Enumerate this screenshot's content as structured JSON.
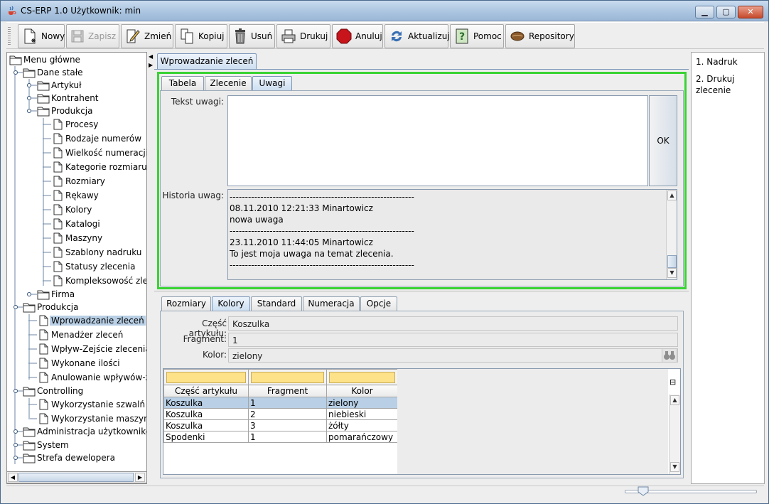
{
  "window": {
    "title": "CS-ERP 1.0  Użytkownik: min",
    "controls": {
      "minimize": "▁",
      "maximize": "▢",
      "close": "✕"
    }
  },
  "toolbar": {
    "buttons": [
      {
        "label": "Nowy",
        "icon": "new-document-icon",
        "enabled": true
      },
      {
        "label": "Zapisz",
        "icon": "save-icon",
        "enabled": false
      },
      {
        "label": "Zmień",
        "icon": "edit-pencil-icon",
        "enabled": true
      },
      {
        "label": "Kopiuj",
        "icon": "copy-icon",
        "enabled": true
      },
      {
        "label": "Usuń",
        "icon": "trash-icon",
        "enabled": true
      },
      {
        "label": "Drukuj",
        "icon": "printer-icon",
        "enabled": true
      },
      {
        "label": "Anuluj",
        "icon": "stop-sign-icon",
        "enabled": true
      },
      {
        "label": "Aktualizuj",
        "icon": "refresh-icon",
        "enabled": true
      },
      {
        "label": "Pomoc",
        "icon": "help-icon",
        "enabled": true
      },
      {
        "label": "Repository",
        "icon": "repository-bean-icon",
        "enabled": true
      }
    ]
  },
  "tree": {
    "items": [
      {
        "label": "Menu główne",
        "type": "folder"
      },
      {
        "label": "Dane stałe",
        "type": "folder"
      },
      {
        "label": "Artykuł",
        "type": "folder"
      },
      {
        "label": "Kontrahent",
        "type": "folder"
      },
      {
        "label": "Produkcja",
        "type": "folder"
      },
      {
        "label": "Procesy",
        "type": "leaf"
      },
      {
        "label": "Rodzaje numerów",
        "type": "leaf"
      },
      {
        "label": "Wielkość numeracji",
        "type": "leaf"
      },
      {
        "label": "Kategorie rozmiaru",
        "type": "leaf"
      },
      {
        "label": "Rozmiary",
        "type": "leaf"
      },
      {
        "label": "Rękawy",
        "type": "leaf"
      },
      {
        "label": "Kolory",
        "type": "leaf"
      },
      {
        "label": "Katalogi",
        "type": "leaf"
      },
      {
        "label": "Maszyny",
        "type": "leaf"
      },
      {
        "label": "Szablony nadruku",
        "type": "leaf"
      },
      {
        "label": "Statusy zlecenia",
        "type": "leaf"
      },
      {
        "label": "Kompleksowość zlecenia",
        "type": "leaf"
      },
      {
        "label": "Firma",
        "type": "folder"
      },
      {
        "label": "Produkcja",
        "type": "folder"
      },
      {
        "label": "Wprowadzanie zleceń",
        "type": "leaf",
        "selected": true
      },
      {
        "label": "Menadżer zleceń",
        "type": "leaf"
      },
      {
        "label": "Wpływ-Zejście zlecenia",
        "type": "leaf"
      },
      {
        "label": "Wykonane ilości",
        "type": "leaf"
      },
      {
        "label": "Anulowanie wpływów-zejść",
        "type": "leaf"
      },
      {
        "label": "Controlling",
        "type": "folder"
      },
      {
        "label": "Wykorzystanie szwalń",
        "type": "leaf"
      },
      {
        "label": "Wykorzystanie maszyn",
        "type": "leaf"
      },
      {
        "label": "Administracja użytkowników",
        "type": "folder"
      },
      {
        "label": "System",
        "type": "folder"
      },
      {
        "label": "Strefa dewelopera",
        "type": "folder"
      }
    ]
  },
  "main": {
    "doc_tab": "Wprowadzanie zleceń",
    "top_tabs": [
      "Tabela",
      "Zlecenie",
      "Uwagi"
    ],
    "top_active_tab": "Uwagi",
    "notes": {
      "text_label": "Tekst uwagi:",
      "text_value": "",
      "ok_label": "OK",
      "history_label": "Historia uwag:",
      "history_lines": [
        "------------------------------------------------------------",
        " 08.11.2010 12:21:33  Minartowicz",
        "nowa uwaga",
        "------------------------------------------------------------",
        " 23.11.2010 11:44:05  Minartowicz",
        "To jest moja uwaga na temat zlecenia.",
        "------------------------------------------------------------"
      ]
    },
    "bottom_tabs": [
      "Rozmiary",
      "Kolory",
      "Standard",
      "Numeracja",
      "Opcje"
    ],
    "bottom_active_tab": "Kolory",
    "colors": {
      "part_label": "Część artykułu:",
      "part_value": "Koszulka",
      "fragment_label": "Fragment:",
      "fragment_value": "1",
      "color_label": "Kolor:",
      "color_value": "zielony",
      "table": {
        "columns": [
          "Część artykułu",
          "Fragment",
          "Kolor"
        ],
        "rows": [
          [
            "Koszulka",
            "1",
            "zielony"
          ],
          [
            "Koszulka",
            "2",
            "niebieski"
          ],
          [
            "Koszulka",
            "3",
            "żółty"
          ],
          [
            "Spodenki",
            "1",
            "pomarańczowy"
          ]
        ],
        "selected_row": 0
      }
    }
  },
  "right_panel": {
    "links": [
      "1. Nadruk",
      "2. Drukuj zlecenie"
    ]
  },
  "colors": {
    "accent_green": "#39d334",
    "selection": "#b8cfe5",
    "filter_yellow": "#fde28a"
  }
}
